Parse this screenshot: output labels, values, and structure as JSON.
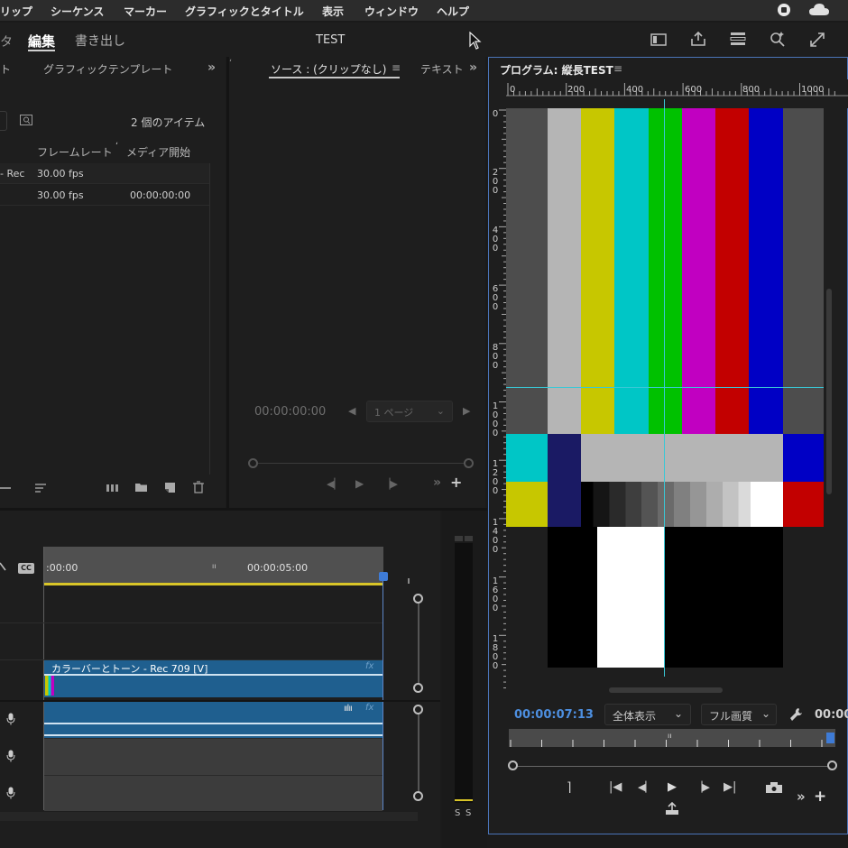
{
  "menubar": {
    "items": [
      "リップ",
      "シーケンス",
      "マーカー",
      "グラフィックとタイトル",
      "表示",
      "ウィンドウ",
      "ヘルプ"
    ]
  },
  "header": {
    "workspace_partial": "タ",
    "edit_tab": "編集",
    "export_tab": "書き出し",
    "project_title": "TEST"
  },
  "project_panel": {
    "tab_partial": "ト",
    "graphics_tab": "グラフィックテンプレート",
    "item_count": "2 個のアイテム",
    "columns": {
      "framerate": "フレームレート",
      "media_start": "メディア開始",
      "sort_mark": "ʻ"
    },
    "rows": [
      {
        "name_partial": "- Rec",
        "framerate": "30.00 fps",
        "media_start": ""
      },
      {
        "name_partial": "",
        "framerate": "30.00 fps",
        "media_start": "00:00:00:00"
      }
    ]
  },
  "source_panel": {
    "title": "ソース : (クリップなし)",
    "text_tab": "テキスト",
    "timecode": "00:00:00:00",
    "page_select": "1 ページ"
  },
  "program_panel": {
    "title": "プログラム: 縦長TEST",
    "ruler_ticks": [
      "0",
      "200",
      "400",
      "600",
      "800",
      "1000"
    ],
    "vruler_ticks": [
      "0",
      "200",
      "400",
      "600",
      "800",
      "1000",
      "1200",
      "1400",
      "1600",
      "1800"
    ],
    "timecode": "00:00:07:13",
    "zoom_select": "全体表示",
    "quality_select": "フル画質",
    "timecode_right": "00:00"
  },
  "timeline": {
    "ruler_start": ":00:00",
    "ruler_mid": "00:00:05:00",
    "cc_label": "CC",
    "video_clip_label": "カラーバーとトーン - Rec 709 [V]",
    "fx_label": "fx"
  },
  "audio_meter": {
    "labels": [
      "S",
      "S"
    ]
  },
  "colors": {
    "accent_blue": "#2d8ceb",
    "clip_blue": "#1f5f8f",
    "timeline_yellow": "#d9c528",
    "guide_cyan": "#39c8d6"
  }
}
